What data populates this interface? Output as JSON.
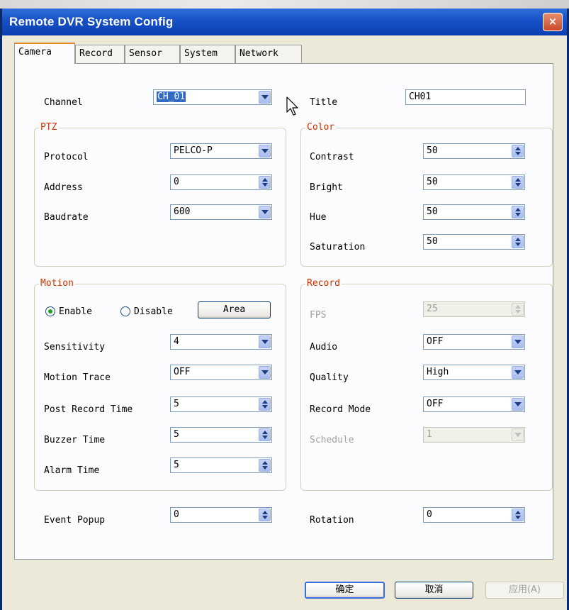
{
  "window": {
    "title": "Remote DVR System Config",
    "close_label": "×"
  },
  "tabs": [
    {
      "label": "Camera",
      "active": true
    },
    {
      "label": "Record",
      "active": false
    },
    {
      "label": "Sensor",
      "active": false
    },
    {
      "label": "System",
      "active": false
    },
    {
      "label": "Network",
      "active": false
    }
  ],
  "top": {
    "channel_label": "Channel",
    "channel_value": "CH_01",
    "title_label": "Title",
    "title_value": "CH01"
  },
  "ptz": {
    "legend": "PTZ",
    "protocol_label": "Protocol",
    "protocol_value": "PELCO-P",
    "address_label": "Address",
    "address_value": "0",
    "baudrate_label": "Baudrate",
    "baudrate_value": "600"
  },
  "color": {
    "legend": "Color",
    "contrast_label": "Contrast",
    "contrast_value": "50",
    "bright_label": "Bright",
    "bright_value": "50",
    "hue_label": "Hue",
    "hue_value": "50",
    "saturation_label": "Saturation",
    "saturation_value": "50"
  },
  "motion": {
    "legend": "Motion",
    "enable_label": "Enable",
    "disable_label": "Disable",
    "selected": "Enable",
    "area_button": "Area",
    "sensitivity_label": "Sensitivity",
    "sensitivity_value": "4",
    "trace_label": "Motion Trace",
    "trace_value": "OFF",
    "post_record_label": "Post Record Time",
    "post_record_value": "5",
    "buzzer_label": "Buzzer Time",
    "buzzer_value": "5",
    "alarm_label": "Alarm Time",
    "alarm_value": "5"
  },
  "record": {
    "legend": "Record",
    "fps_label": "FPS",
    "fps_value": "25",
    "audio_label": "Audio",
    "audio_value": "OFF",
    "quality_label": "Quality",
    "quality_value": "High",
    "mode_label": "Record Mode",
    "mode_value": "OFF",
    "schedule_label": "Schedule",
    "schedule_value": "1"
  },
  "bottom": {
    "event_popup_label": "Event Popup",
    "event_popup_value": "0",
    "rotation_label": "Rotation",
    "rotation_value": "0"
  },
  "buttons": {
    "ok": "确定",
    "cancel": "取消",
    "apply": "应用(A)"
  },
  "colors": {
    "titlebar": "#1650c8",
    "legend": "#cc3300",
    "face": "#ece9d8",
    "tab_accent": "#e68b2c"
  }
}
